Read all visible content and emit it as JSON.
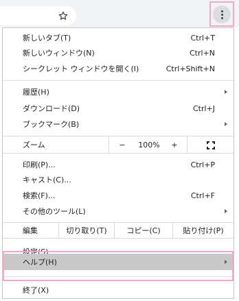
{
  "toolbar": {
    "bookmark_icon": "star-outline-icon",
    "menu_icon": "kebab-menu-icon"
  },
  "menu": {
    "items_top": [
      {
        "label": "新しいタブ(T)",
        "shortcut": "Ctrl+T"
      },
      {
        "label": "新しいウィンドウ(N)",
        "shortcut": "Ctrl+N"
      },
      {
        "label": "シークレット ウィンドウを開く(I)",
        "shortcut": "Ctrl+Shift+N"
      }
    ],
    "items_mid": [
      {
        "label": "履歴(H)",
        "shortcut": "",
        "submenu": true
      },
      {
        "label": "ダウンロード(D)",
        "shortcut": "Ctrl+J",
        "submenu": false
      },
      {
        "label": "ブックマーク(B)",
        "shortcut": "",
        "submenu": true
      }
    ],
    "zoom": {
      "label": "ズーム",
      "minus": "−",
      "value": "100%",
      "plus": "+",
      "fullscreen_icon": "fullscreen-icon"
    },
    "items_tools": [
      {
        "label": "印刷(P)...",
        "shortcut": "Ctrl+P",
        "submenu": false
      },
      {
        "label": "キャスト(C)...",
        "shortcut": "",
        "submenu": false
      },
      {
        "label": "検索(F)...",
        "shortcut": "Ctrl+F",
        "submenu": false
      },
      {
        "label": "その他のツール(L)",
        "shortcut": "",
        "submenu": true
      }
    ],
    "edit": {
      "label": "編集",
      "cut": "切り取り(T)",
      "copy": "コピー(C)",
      "paste": "貼り付け(P)"
    },
    "settings": {
      "label": "設定(S)"
    },
    "help": {
      "label": "ヘルプ(H)",
      "submenu": true
    },
    "exit": {
      "label": "終了(X)"
    }
  }
}
